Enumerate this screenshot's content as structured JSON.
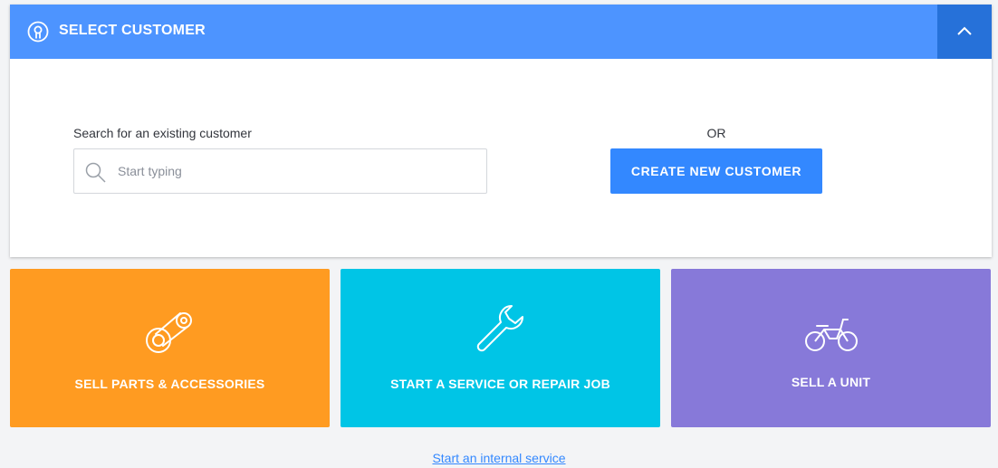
{
  "header": {
    "title": "SELECT CUSTOMER",
    "icon": "customer-icon",
    "collapse_icon": "chevron-up-icon",
    "color": "#4d94ff"
  },
  "search": {
    "label": "Search for an existing customer",
    "placeholder": "Start typing",
    "value": ""
  },
  "or_label": "OR",
  "create_button": {
    "label": "CREATE NEW CUSTOMER",
    "color": "#3388ff"
  },
  "tiles": [
    {
      "label": "SELL PARTS & ACCESSORIES",
      "icon": "parts-chain-icon",
      "color": "#ff9b21"
    },
    {
      "label": "START A SERVICE OR REPAIR JOB",
      "icon": "wrench-icon",
      "color": "#00c5e6"
    },
    {
      "label": "SELL A UNIT",
      "icon": "motorcycle-icon",
      "color": "#8779d9"
    }
  ],
  "internal_service_link": "Start an internal service"
}
